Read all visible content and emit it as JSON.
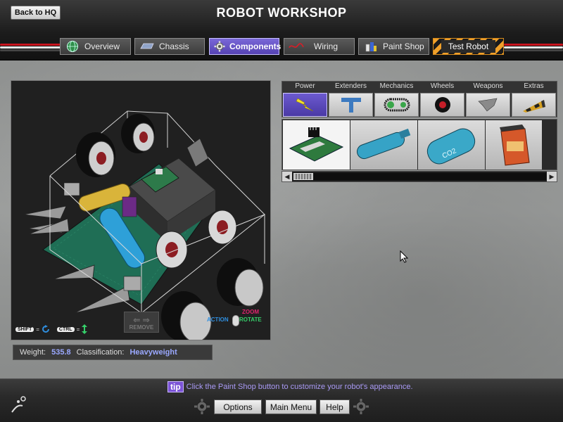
{
  "header": {
    "back_label": "Back to HQ",
    "title": "ROBOT WORKSHOP"
  },
  "tabs": [
    {
      "label": "Overview",
      "icon": "globe-icon"
    },
    {
      "label": "Chassis",
      "icon": "chassis-icon"
    },
    {
      "label": "Components",
      "icon": "gear-icon",
      "active": true
    },
    {
      "label": "Wiring",
      "icon": "wire-icon"
    },
    {
      "label": "Paint Shop",
      "icon": "paint-cans-icon"
    },
    {
      "label": "Test Robot",
      "icon": "hazard-stripes"
    }
  ],
  "viewport": {
    "hint_shift": "SHIFT",
    "hint_ctrl": "CTRL",
    "remove_label": "REMOVE",
    "mouse_zoom": "ZOOM",
    "mouse_action": "ACTION",
    "mouse_rotate": "ROTATE"
  },
  "stats": {
    "weight_label": "Weight:",
    "weight_value": "535.8",
    "class_label": "Classification:",
    "class_value": "Heavyweight"
  },
  "categories": [
    {
      "label": "Power",
      "icon": "lightning-icon",
      "active": true
    },
    {
      "label": "Extenders",
      "icon": "t-extender-icon"
    },
    {
      "label": "Mechanics",
      "icon": "chain-drive-icon"
    },
    {
      "label": "Wheels",
      "icon": "wheel-icon"
    },
    {
      "label": "Weapons",
      "icon": "blade-icon"
    },
    {
      "label": "Extras",
      "icon": "wedge-icon"
    }
  ],
  "components": [
    {
      "name": "circuit-board-item",
      "icon": "circuit-board-icon",
      "selected": true
    },
    {
      "name": "battery-cylinder-item",
      "icon": "battery-icon"
    },
    {
      "name": "co2-tank-item",
      "icon": "co2-tank-icon"
    },
    {
      "name": "orange-battery-box-item",
      "icon": "battery-box-icon"
    }
  ],
  "footer": {
    "tip_icon": "tip",
    "tip_text": "Click the Paint Shop button to customize your robot's appearance.",
    "options_label": "Options",
    "main_menu_label": "Main Menu",
    "help_label": "Help"
  },
  "colors": {
    "accent_purple": "#6c5ad0",
    "stat_value": "#9aa8ff",
    "hazard_orange": "#f0a02a"
  }
}
